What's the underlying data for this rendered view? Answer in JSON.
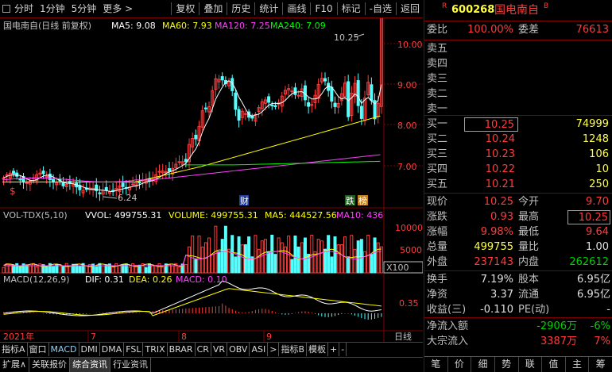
{
  "toolbar": {
    "items": [
      "分时",
      "1分钟",
      "5分钟",
      "更多 >"
    ],
    "buttons": [
      "复权",
      "叠加",
      "历史",
      "统计",
      "画线",
      "F10",
      "标记",
      "-自选",
      "返回"
    ]
  },
  "chart": {
    "title": "国电南自(日线 前复权)",
    "ma": [
      {
        "label": "MA5: 9.08",
        "color": "#ffffff"
      },
      {
        "label": "MA60: 7.93",
        "color": "#ffff00"
      },
      {
        "label": "MA120: 7.25",
        "color": "#ff40ff"
      },
      {
        "label": "MA240: 7.09",
        "color": "#00ff00"
      }
    ],
    "price_ticks": [
      "10.00",
      "9.00",
      "8.00",
      "7.00"
    ],
    "high_label": "10.25",
    "low_label": "6.24",
    "markers": {
      "cai": "财",
      "die": "跌",
      "bang": "榜",
      "s": "$"
    },
    "vol_header": {
      "name": "VOL-TDX(5,10)",
      "vvol": "VVOL: 499755.31",
      "volume": "VOLUME: 499755.31",
      "ma5": "MA5: 444527.56",
      "ma10": "MA10: 436"
    },
    "vol_ticks": [
      "10000",
      "5000"
    ],
    "vol_unit": "X100",
    "macd_header": {
      "name": "MACD(12,26,9)",
      "dif": "DIF: 0.31",
      "dea": "DEA: 0.26",
      "macd": "MACD: 0.10"
    },
    "macd_tick": "0.35",
    "dates": {
      "year": "2021年",
      "m7": "7",
      "m8": "8",
      "m9": "9"
    },
    "period": "日线"
  },
  "bottom_tabs1": [
    "指标A",
    "窗口",
    "MACD",
    "DMI",
    "DMA",
    "FSL",
    "TRIX",
    "BRAR",
    "CR",
    "VR",
    "OBV",
    "ASI",
    ">",
    "指标B",
    "模板",
    "+",
    "-"
  ],
  "bottom_tabs2": [
    "扩展∧",
    "关联报价",
    "综合资讯",
    "行业资讯"
  ],
  "panel": {
    "badge": "R",
    "code": "600268",
    "name": "国电南自",
    "badge2": "B",
    "weibi_label": "委比",
    "weibi": "100.00%",
    "weicha_label": "委差",
    "weicha": "76613",
    "sells": [
      {
        "label": "卖五"
      },
      {
        "label": "卖四"
      },
      {
        "label": "卖三"
      },
      {
        "label": "卖二"
      },
      {
        "label": "卖一"
      }
    ],
    "buys": [
      {
        "label": "买一",
        "price": "10.25",
        "vol": "74999"
      },
      {
        "label": "买二",
        "price": "10.24",
        "vol": "1248"
      },
      {
        "label": "买三",
        "price": "10.23",
        "vol": "106"
      },
      {
        "label": "买四",
        "price": "10.22",
        "vol": "10"
      },
      {
        "label": "买五",
        "price": "10.21",
        "vol": "250"
      }
    ],
    "stats": [
      {
        "l1": "现价",
        "v1": "10.25",
        "c1": "red",
        "l2": "今开",
        "v2": "9.70",
        "c2": "red"
      },
      {
        "l1": "涨跌",
        "v1": "0.93",
        "c1": "red",
        "l2": "最高",
        "v2": "10.25",
        "c2": "red"
      },
      {
        "l1": "涨幅",
        "v1": "9.98%",
        "c1": "red",
        "l2": "最低",
        "v2": "9.64",
        "c2": "red"
      },
      {
        "l1": "总量",
        "v1": "499755",
        "c1": "yellow",
        "l2": "量比",
        "v2": "1.00",
        "c2": "white"
      },
      {
        "l1": "外盘",
        "v1": "237143",
        "c1": "red",
        "l2": "内盘",
        "v2": "262612",
        "c2": "green"
      }
    ],
    "stats2": [
      {
        "l1": "换手",
        "v1": "7.19%",
        "l2": "股本",
        "v2": "6.95亿"
      },
      {
        "l1": "净资",
        "v1": "3.37",
        "l2": "流通",
        "v2": "6.95亿"
      },
      {
        "l1": "收益(三)",
        "v1": "-0.110",
        "l2": "PE(动)",
        "v2": "-"
      }
    ],
    "flow": [
      {
        "label": "净流入额",
        "v": "-2906万",
        "p": "-6%",
        "c": "green"
      },
      {
        "label": "大宗流入",
        "v": "3387万",
        "p": "7%",
        "c": "red"
      }
    ],
    "tabs": [
      "笔",
      "价",
      "细",
      "势",
      "联",
      "值",
      "主",
      "筹"
    ]
  },
  "colors": {
    "up": "#ff3c3c",
    "down": "#54ffff",
    "ma5": "#ffffff",
    "ma60": "#ffff00",
    "ma120": "#ff40ff",
    "ma240": "#00ff00",
    "grid": "#800000"
  }
}
